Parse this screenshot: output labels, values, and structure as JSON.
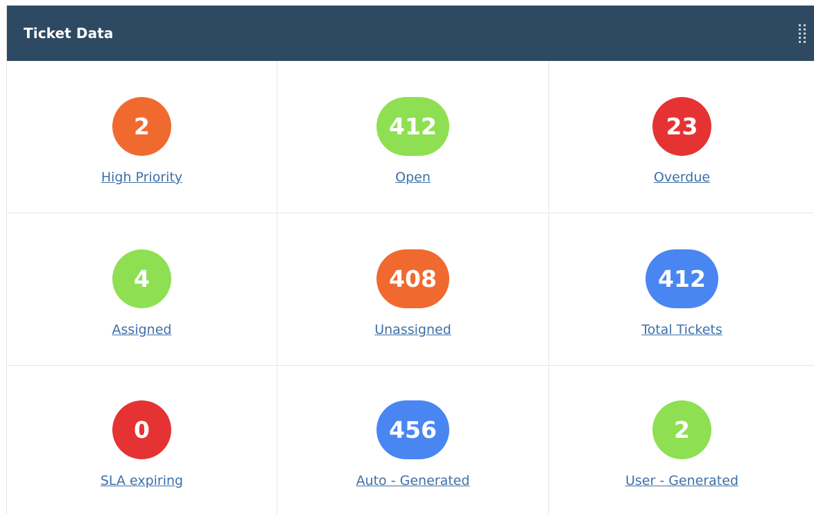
{
  "widget": {
    "title": "Ticket Data"
  },
  "colors": {
    "header_bg": "#2e4a62",
    "orange": "#f06a30",
    "green": "#8ee052",
    "red": "#e53333",
    "blue": "#4a86f2",
    "link": "#3d6fa8"
  },
  "tiles": [
    {
      "value": "2",
      "label": "High Priority",
      "color": "#f06a30"
    },
    {
      "value": "412",
      "label": "Open",
      "color": "#8ee052"
    },
    {
      "value": "23",
      "label": "Overdue",
      "color": "#e53333"
    },
    {
      "value": "4",
      "label": "Assigned",
      "color": "#8ee052"
    },
    {
      "value": "408",
      "label": "Unassigned",
      "color": "#f06a30"
    },
    {
      "value": "412",
      "label": "Total Tickets",
      "color": "#4a86f2"
    },
    {
      "value": "0",
      "label": "SLA expiring",
      "color": "#e53333"
    },
    {
      "value": "456",
      "label": "Auto - Generated",
      "color": "#4a86f2"
    },
    {
      "value": "2",
      "label": "User - Generated",
      "color": "#8ee052"
    }
  ]
}
